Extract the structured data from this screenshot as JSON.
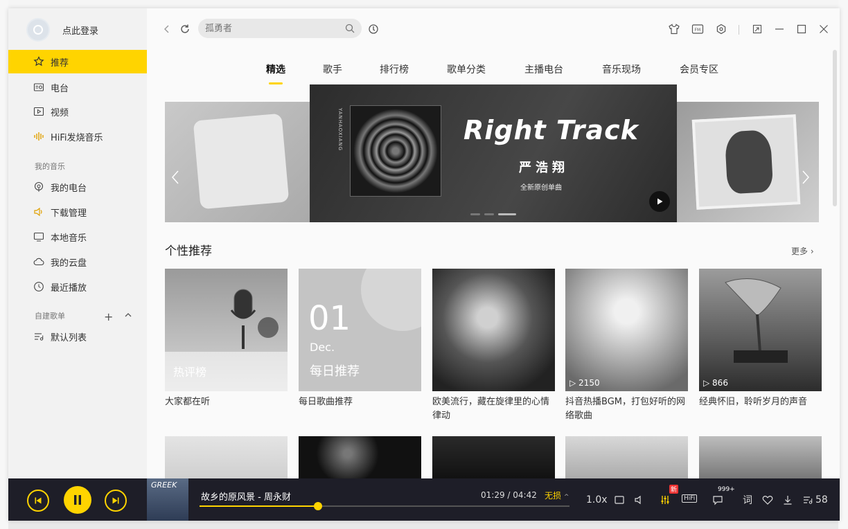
{
  "sidebar": {
    "login_text": "点此登录",
    "main_items": [
      {
        "label": "推荐",
        "icon": "star-icon",
        "active": true
      },
      {
        "label": "电台",
        "icon": "radio-icon"
      },
      {
        "label": "视频",
        "icon": "video-icon"
      },
      {
        "label": "HiFi发烧音乐",
        "icon": "hifi-wave-icon"
      }
    ],
    "my_music_title": "我的音乐",
    "my_music_items": [
      {
        "label": "我的电台",
        "icon": "podcast-icon"
      },
      {
        "label": "下载管理",
        "icon": "speaker-download-icon"
      },
      {
        "label": "本地音乐",
        "icon": "monitor-icon"
      },
      {
        "label": "我的云盘",
        "icon": "cloud-icon"
      },
      {
        "label": "最近播放",
        "icon": "clock-icon"
      }
    ],
    "playlist_title": "自建歌单",
    "playlist_items": [
      {
        "label": "默认列表",
        "icon": "list-icon"
      }
    ]
  },
  "topbar": {
    "search_placeholder": "孤勇者"
  },
  "tabs": [
    "精选",
    "歌手",
    "排行榜",
    "歌单分类",
    "主播电台",
    "音乐现场",
    "会员专区"
  ],
  "banner": {
    "title": "Right Track",
    "artist": "严浩翔",
    "subtitle": "全新原创单曲",
    "vertical_text": "YANHAOXIANG"
  },
  "recommend": {
    "title": "个性推荐",
    "more": "更多",
    "cards": [
      {
        "caption": "大家都在听",
        "overlay": "热评榜",
        "count": ""
      },
      {
        "caption": "每日歌曲推荐",
        "day": "01",
        "month": "Dec.",
        "overlay": "每日推荐",
        "count": ""
      },
      {
        "caption": "欧美流行，藏在旋律里的心情律动",
        "count": ""
      },
      {
        "caption": "抖音热播BGM，打包好听的网络歌曲",
        "count": "2150"
      },
      {
        "caption": "经典怀旧，聆听岁月的声音",
        "count": "866"
      }
    ]
  },
  "player": {
    "song": "故乡的原风景 - 周永财",
    "current_time": "01:29",
    "total_time": "/ 04:42",
    "quality": "无损",
    "speed": "1.0x",
    "hifi": "HiFi",
    "new_badge": "新",
    "comment_count": "999+",
    "lyric": "词",
    "playlist_count": "58",
    "progress": 0.32,
    "cover_text": "GREEK"
  },
  "colors": {
    "accent": "#ffd400",
    "player_bg": "#1e1e28",
    "sidebar_bg": "#f2f2f2"
  }
}
